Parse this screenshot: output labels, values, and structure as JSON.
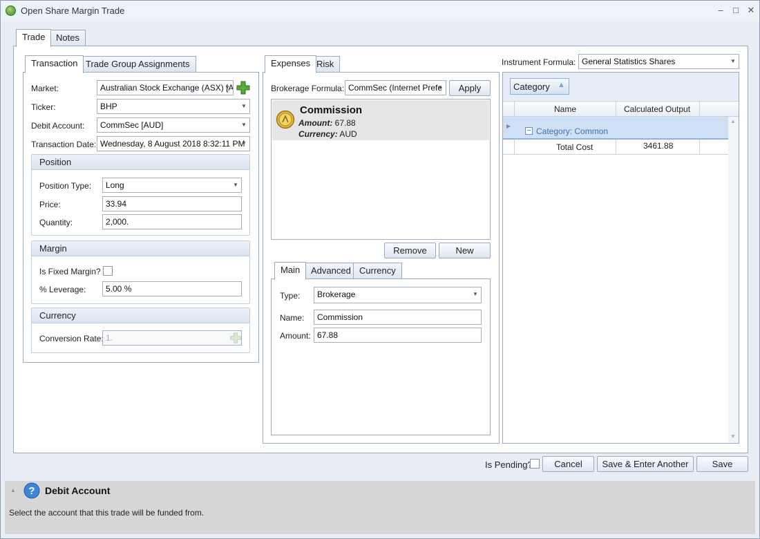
{
  "window": {
    "title": "Open Share Margin Trade"
  },
  "main_tabs": [
    "Trade",
    "Notes"
  ],
  "left_tabs": [
    "Transaction",
    "Trade Group Assignments"
  ],
  "transaction": {
    "market_label": "Market:",
    "market_value": "Australian Stock Exchange (ASX) [A",
    "ticker_label": "Ticker:",
    "ticker_value": "BHP",
    "debit_label": "Debit Account:",
    "debit_value": "CommSec [AUD]",
    "date_label": "Transaction Date:",
    "date_value": "Wednesday, 8 August 2018 8:32:11 PM"
  },
  "position": {
    "header": "Position",
    "type_label": "Position Type:",
    "type_value": "Long",
    "price_label": "Price:",
    "price_value": "33.94",
    "qty_label": "Quantity:",
    "qty_value": "2,000."
  },
  "margin": {
    "header": "Margin",
    "fixed_label": "Is Fixed Margin?",
    "leverage_label": "% Leverage:",
    "leverage_value": "5.00 %"
  },
  "currency": {
    "header": "Currency",
    "rate_label": "Conversion Rate:",
    "rate_value": "1."
  },
  "mid_tabs": [
    "Expenses",
    "Risk"
  ],
  "expenses": {
    "formula_label": "Brokerage Formula:",
    "formula_value": "CommSec (Internet Prefe",
    "apply": "Apply",
    "item_title": "Commission",
    "item_amount_label": "Amount:",
    "item_amount": "67.88",
    "item_currency_label": "Currency:",
    "item_currency": "AUD",
    "remove": "Remove",
    "new": "New"
  },
  "detail_tabs": [
    "Main",
    "Advanced",
    "Currency"
  ],
  "detail": {
    "type_label": "Type:",
    "type_value": "Brokerage",
    "name_label": "Name:",
    "name_value": "Commission",
    "amount_label": "Amount:",
    "amount_value": "67.88"
  },
  "instrument": {
    "label": "Instrument Formula:",
    "value": "General Statistics Shares",
    "group_chip": "Category",
    "columns": [
      "Name",
      "Calculated Output"
    ],
    "group_row": "Category: Common",
    "rows": [
      {
        "name": "Total Cost",
        "output": "3461.88"
      }
    ]
  },
  "footer": {
    "pending_label": "Is Pending?",
    "cancel": "Cancel",
    "save_another": "Save & Enter Another",
    "save": "Save"
  },
  "help": {
    "title": "Debit Account",
    "text": "Select the account that this trade will be funded from."
  },
  "colors": {
    "accent": "#3a7fd0",
    "selected_row": "#cfe0f5",
    "help_bg": "#d6d6d6"
  }
}
